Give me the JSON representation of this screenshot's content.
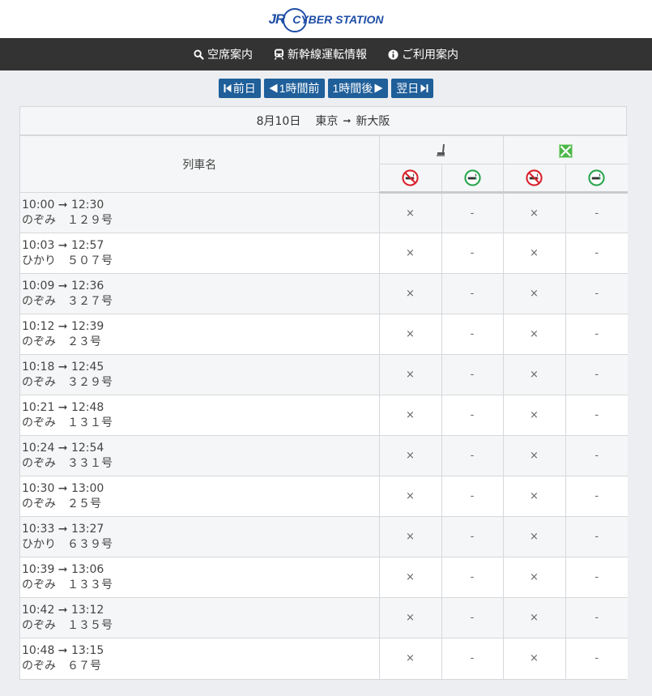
{
  "header": {
    "logo_jr": "JR",
    "logo_text": "CYBER STATION"
  },
  "nav": [
    {
      "label": "空席案内",
      "icon": "search-icon"
    },
    {
      "label": "新幹線運転情報",
      "icon": "train-icon"
    },
    {
      "label": "ご利用案内",
      "icon": "info-icon"
    }
  ],
  "date_nav": {
    "prev_day": "前日",
    "prev_hour": "1時間前",
    "next_hour": "1時間後",
    "next_day": "翌日"
  },
  "route": {
    "date": "8月10日",
    "from": "東京",
    "arrow": "➞",
    "to": "新大阪"
  },
  "table": {
    "name_header": "列車名",
    "seat_classes": [
      {
        "icon": "ordinary-seat-icon",
        "sub": [
          "no-smoking-icon",
          "smoking-icon"
        ]
      },
      {
        "icon": "green-car-icon",
        "sub": [
          "no-smoking-icon",
          "smoking-icon"
        ]
      }
    ],
    "colors": {
      "no_smoking": "#d9232e",
      "smoking": "#2aa64f",
      "green": "#4cb848"
    },
    "rows": [
      {
        "time": "10:00 ➞ 12:30",
        "train": "のぞみ　１２９号",
        "c1": "×",
        "c2": "-",
        "c3": "×",
        "c4": "-"
      },
      {
        "time": "10:03 ➞ 12:57",
        "train": "ひかり　５０７号",
        "c1": "×",
        "c2": "-",
        "c3": "×",
        "c4": "-"
      },
      {
        "time": "10:09 ➞ 12:36",
        "train": "のぞみ　３２７号",
        "c1": "×",
        "c2": "-",
        "c3": "×",
        "c4": "-"
      },
      {
        "time": "10:12 ➞ 12:39",
        "train": "のぞみ　２３号",
        "c1": "×",
        "c2": "-",
        "c3": "×",
        "c4": "-"
      },
      {
        "time": "10:18 ➞ 12:45",
        "train": "のぞみ　３２９号",
        "c1": "×",
        "c2": "-",
        "c3": "×",
        "c4": "-"
      },
      {
        "time": "10:21 ➞ 12:48",
        "train": "のぞみ　１３１号",
        "c1": "×",
        "c2": "-",
        "c3": "×",
        "c4": "-"
      },
      {
        "time": "10:24 ➞ 12:54",
        "train": "のぞみ　３３１号",
        "c1": "×",
        "c2": "-",
        "c3": "×",
        "c4": "-"
      },
      {
        "time": "10:30 ➞ 13:00",
        "train": "のぞみ　２５号",
        "c1": "×",
        "c2": "-",
        "c3": "×",
        "c4": "-"
      },
      {
        "time": "10:33 ➞ 13:27",
        "train": "ひかり　６３９号",
        "c1": "×",
        "c2": "-",
        "c3": "×",
        "c4": "-"
      },
      {
        "time": "10:39 ➞ 13:06",
        "train": "のぞみ　１３３号",
        "c1": "×",
        "c2": "-",
        "c3": "×",
        "c4": "-"
      },
      {
        "time": "10:42 ➞ 13:12",
        "train": "のぞみ　１３５号",
        "c1": "×",
        "c2": "-",
        "c3": "×",
        "c4": "-"
      },
      {
        "time": "10:48 ➞ 13:15",
        "train": "のぞみ　６７号",
        "c1": "×",
        "c2": "-",
        "c3": "×",
        "c4": "-"
      }
    ]
  }
}
